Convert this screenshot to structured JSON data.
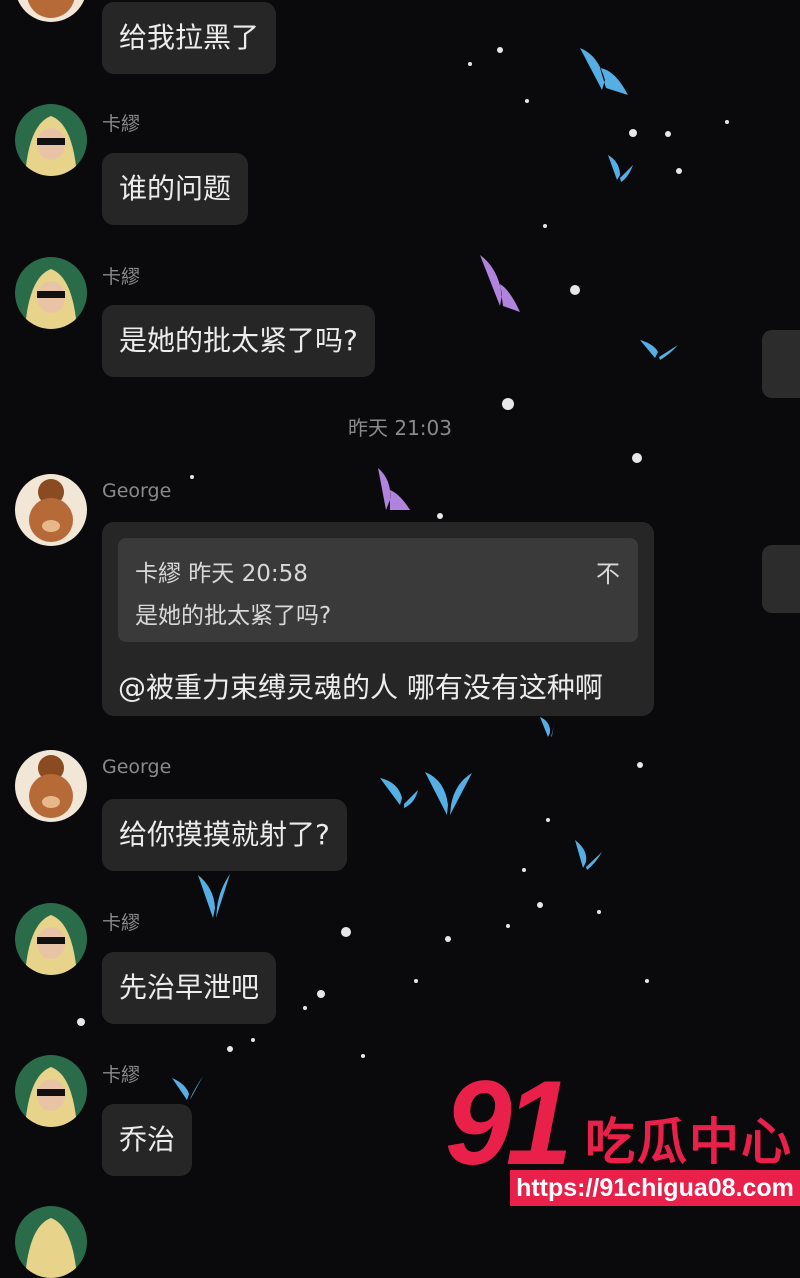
{
  "messages": [
    {
      "sender": "",
      "text": "给我拉黑了"
    },
    {
      "sender": "卡繆",
      "text": "谁的问题"
    },
    {
      "sender": "卡繆",
      "text": "是她的批太紧了吗?"
    },
    {
      "sender": "George",
      "text": "给你摸摸就射了?"
    },
    {
      "sender": "卡繆",
      "text": "先治早泄吧"
    },
    {
      "sender": "卡繆",
      "text": "乔治"
    }
  ],
  "timestamp": "昨天 21:03",
  "reply": {
    "sender": "George",
    "quote_head": "卡繆 昨天 20:58",
    "quote_body": "是她的批太紧了吗?",
    "quote_close": "不",
    "text": "@被重力束缚灵魂的人 哪有没有这种啊"
  },
  "watermark": {
    "number": "91",
    "name": "吃瓜中心",
    "url": "https://91chigua08.com"
  },
  "colors": {
    "background": "#0a0a0c",
    "bubble": "#262626",
    "quote": "#3a3a3a",
    "watermark": "#e8204a",
    "butterfly_blue": "#5ab8f0",
    "butterfly_purple": "#b98ae8"
  },
  "icons": [
    "avatar-blonde",
    "avatar-bear",
    "butterfly-icon",
    "star-dot"
  ]
}
